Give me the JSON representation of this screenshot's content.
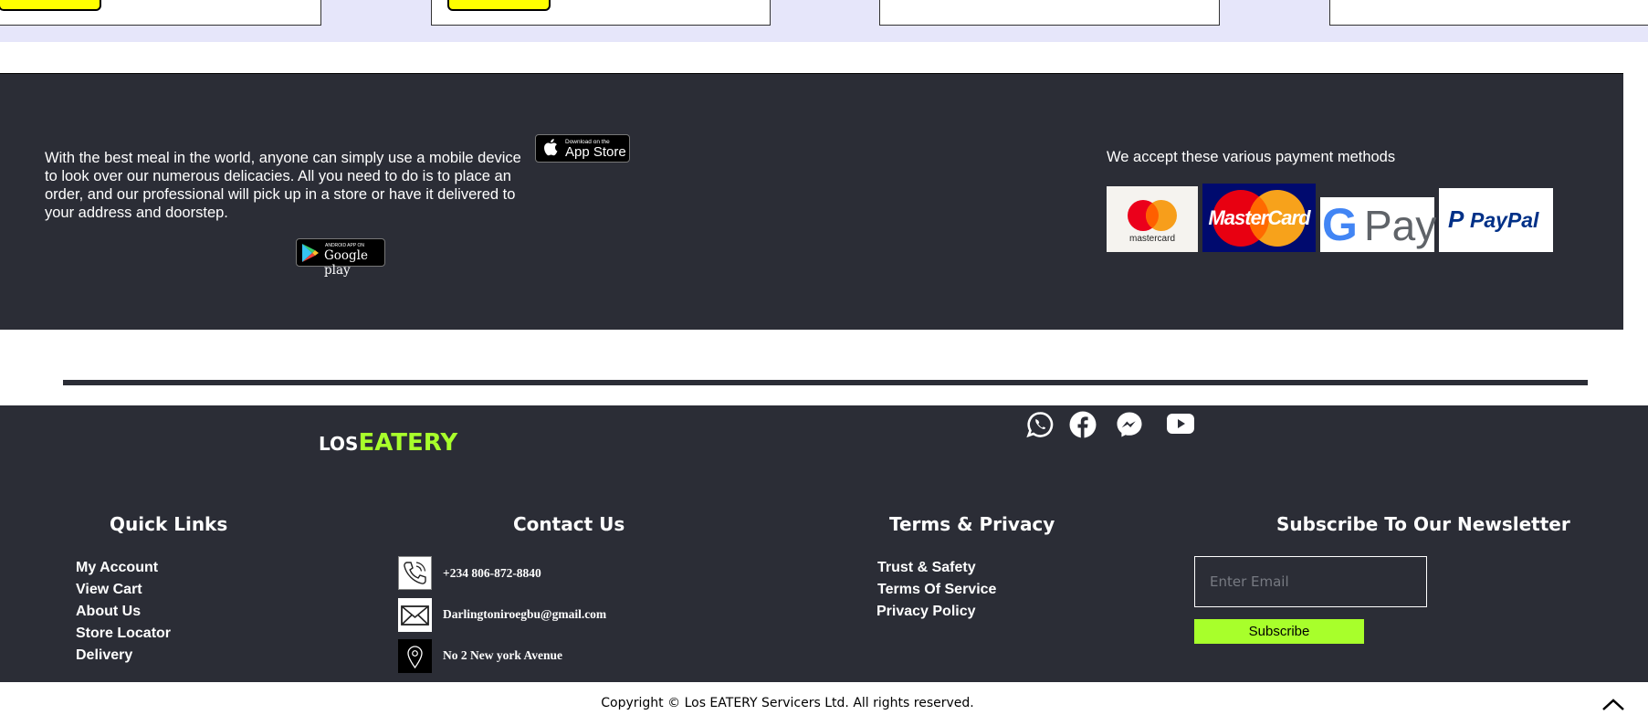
{
  "app_section": {
    "description": "With the best meal in the world, anyone can simply use a mobile device to look over our numerous delicacies. All you need to do is to place an order, and our professional will pick up in a store or have it delivered to your address and doorstep.",
    "app_store": {
      "small": "Download on the",
      "big": "App Store"
    },
    "google_play": {
      "small": "ANDROID APP ON",
      "big": "Google play"
    },
    "payment_text": "We accept these various payment methods",
    "payment_methods": [
      {
        "name": "mastercard",
        "label": "mastercard"
      },
      {
        "name": "MasterCard",
        "label": "MasterCard"
      },
      {
        "name": "G Pay",
        "label": "Pay"
      },
      {
        "name": "PayPal",
        "label": "PayPal"
      }
    ]
  },
  "footer": {
    "logo": {
      "prefix": "LOS",
      "name": "EATERY"
    },
    "social": [
      "whatsapp-icon",
      "facebook-icon",
      "messenger-icon",
      "youtube-icon"
    ],
    "quick_links": {
      "title": "Quick Links",
      "items": [
        "My Account",
        "View Cart",
        "About Us",
        "Store Locator",
        "Delivery"
      ]
    },
    "contact": {
      "title": "Contact Us",
      "phone": "+234 806-872-8840",
      "email": "Darlingtoniroegbu@gmail.com",
      "address": "No 2 New york Avenue"
    },
    "terms": {
      "title": "Terms & Privacy",
      "items": [
        "Trust & Safety",
        "Terms Of Service",
        "Privacy Policy"
      ]
    },
    "newsletter": {
      "title": "Subscribe To Our Newsletter",
      "placeholder": "Enter Email",
      "button": "Subscribe"
    },
    "copyright": "Copyright © Los EATERY Servicers Ltd. All rights reserved."
  },
  "colors": {
    "dark": "#2b2d36",
    "accent": "#a8ff2b",
    "strip": "#e6e6fa"
  }
}
